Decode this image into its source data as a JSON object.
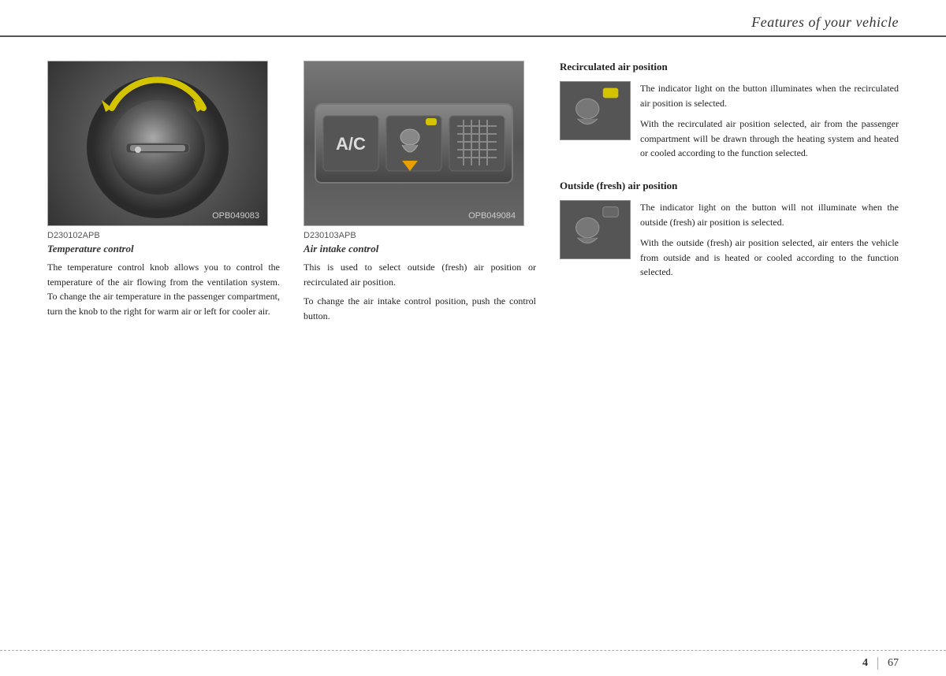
{
  "header": {
    "title": "Features of your vehicle",
    "divider": true
  },
  "left_col1": {
    "image_code": "OPB049083",
    "section_code": "D230102APB",
    "title": "Temperature control",
    "text": "The temperature control knob allows you to control the temperature of the air flowing from the ventilation system. To change the air temperature in the passenger compartment, turn the knob to the right for warm air or left for cooler air."
  },
  "left_col2": {
    "image_code": "OPB049084",
    "section_code": "D230103APB",
    "title": "Air intake control",
    "text": "This is used to select outside (fresh) air position or recirculated air position.",
    "text2": "To change the air intake control position, push the control button."
  },
  "right_col": {
    "section1": {
      "title": "Recirculated air position",
      "text1": "The indicator light on the button illuminates when the recirculated air position is selected.",
      "text2": "With the recirculated air position selected, air from the passenger compartment will be drawn through the heating system and heated or cooled according to the function selected."
    },
    "section2": {
      "title": "Outside (fresh) air position",
      "text1": "The indicator light on the button will not illuminate when the outside (fresh) air position is selected.",
      "text2": "With the outside (fresh) air position selected, air enters the vehicle from outside and is heated or cooled according to the function selected."
    }
  },
  "footer": {
    "page_left": "4",
    "page_right": "67"
  }
}
